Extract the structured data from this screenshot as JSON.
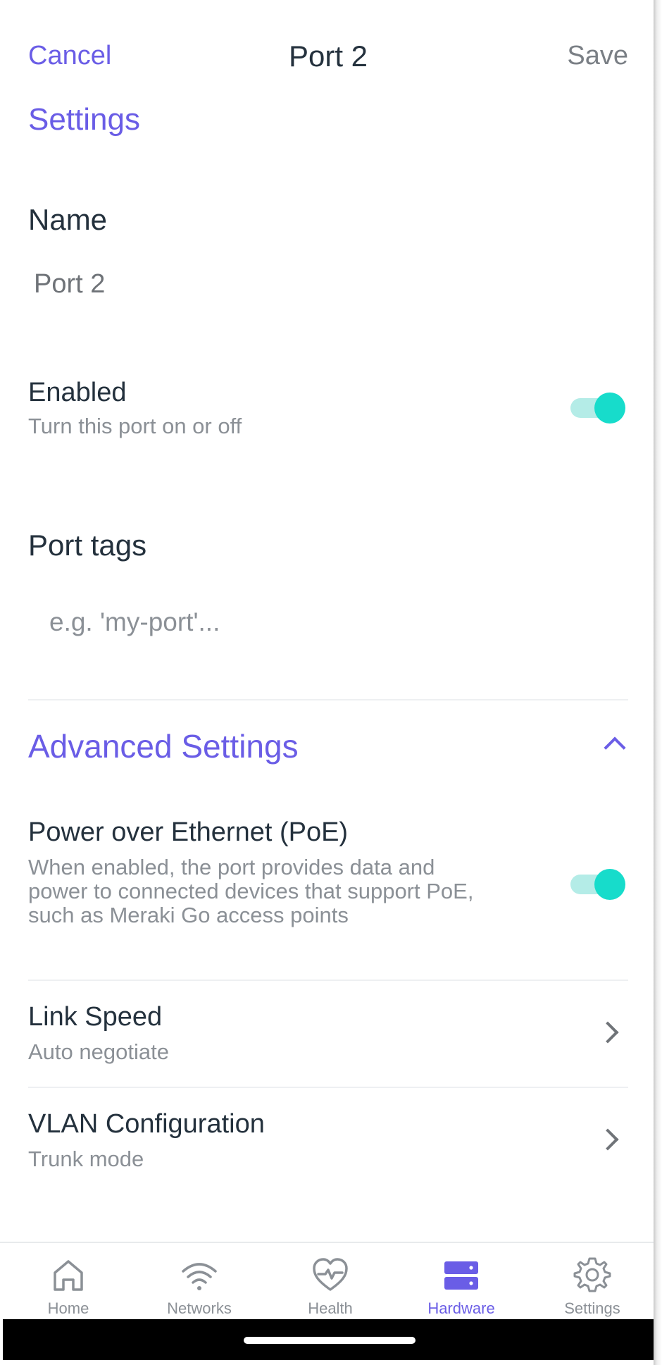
{
  "header": {
    "cancel_label": "Cancel",
    "title": "Port 2",
    "save_label": "Save"
  },
  "settings_heading": "Settings",
  "name": {
    "label": "Name",
    "value": "Port 2"
  },
  "enabled": {
    "title": "Enabled",
    "subtitle": "Turn this port on or off",
    "on": true
  },
  "port_tags": {
    "label": "Port tags",
    "placeholder": "e.g. 'my-port'..."
  },
  "advanced": {
    "heading": "Advanced Settings",
    "expanded": true,
    "poe": {
      "title": "Power over Ethernet (PoE)",
      "subtitle": "When enabled, the port provides data and power to connected devices that support PoE, such as Meraki Go access points",
      "on": true
    },
    "link_speed": {
      "title": "Link Speed",
      "value": "Auto negotiate"
    },
    "vlan": {
      "title": "VLAN Configuration",
      "value": "Trunk mode"
    }
  },
  "tabs": [
    {
      "label": "Home",
      "icon": "home-icon"
    },
    {
      "label": "Networks",
      "icon": "wifi-icon"
    },
    {
      "label": "Health",
      "icon": "health-heart-icon"
    },
    {
      "label": "Hardware",
      "icon": "hardware-server-icon",
      "active": true
    },
    {
      "label": "Settings",
      "icon": "gear-icon"
    }
  ],
  "colors": {
    "accent": "#6a5de6",
    "toggle_on": "#17dccb",
    "toggle_track": "#b4ece7",
    "text_primary": "#24313d",
    "text_secondary": "#8b9096"
  }
}
